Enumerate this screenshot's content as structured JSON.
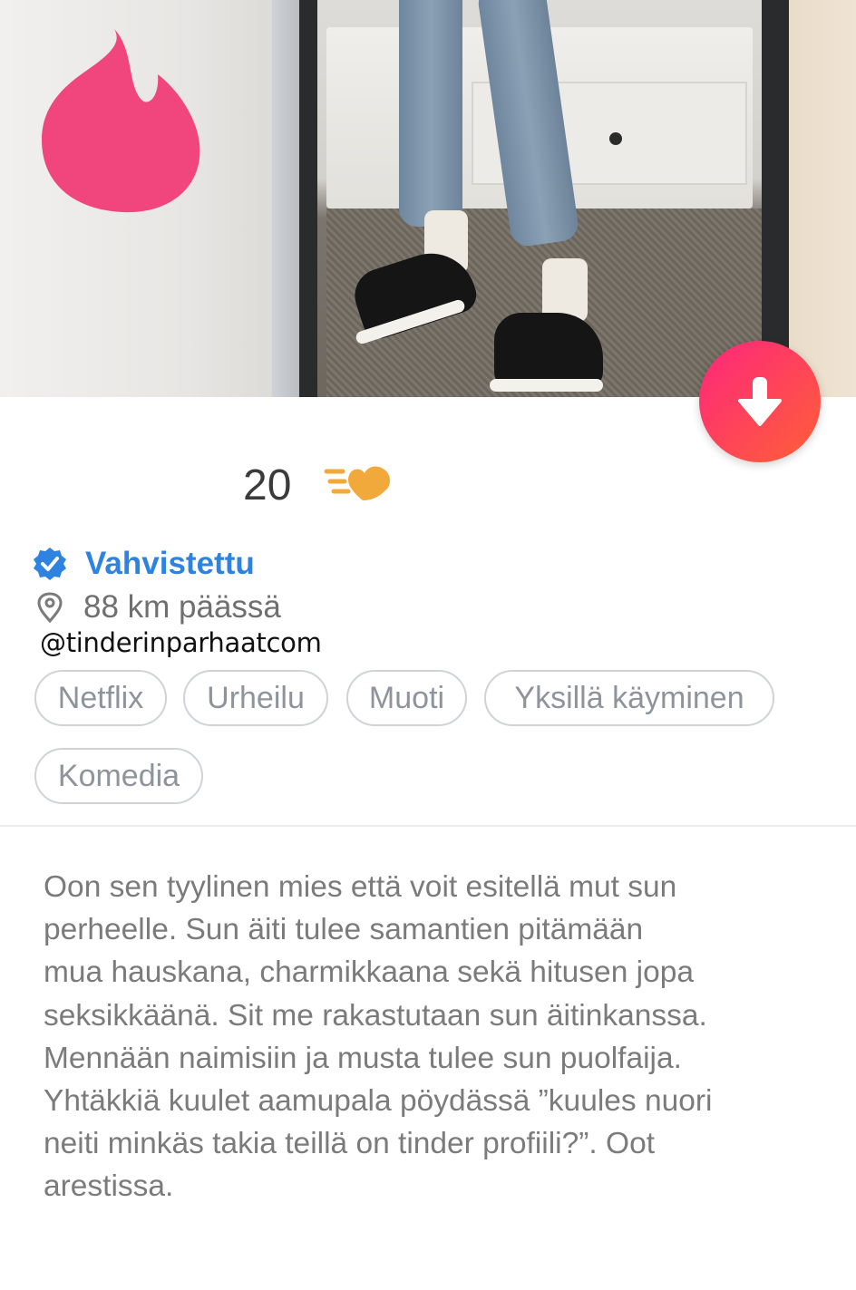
{
  "profile": {
    "age": "20",
    "verified_label": "Vahvistettu",
    "distance": "88 km päässä",
    "watermark": "@tinderinparhaatcom",
    "interests": [
      "Netflix",
      "Urheilu",
      "Muoti",
      "Yksillä käyminen",
      "Komedia"
    ],
    "bio": "Oon sen tyylinen mies että voit esitellä mut sun\nperheelle. Sun äiti tulee samantien pitämään\nmua hauskana, charmikkaana sekä hitusen jopa\nseksikkäänä. Sit me rakastutaan sun äitinkanssa.\nMennään naimisiin ja musta tulee sun puolfaija.\nYhtäkkiä kuulet aamupala pöydässä ”kuules nuori\nneiti minkäs takia teillä on tinder profiili?”. Oot\narestissa."
  },
  "icons": {
    "logo": "tinder-flame-icon",
    "collapse": "arrow-down-icon",
    "swipe": "swipe-heart-icon",
    "verified": "verified-badge-icon",
    "location": "location-pin-icon"
  },
  "colors": {
    "brand_pink": "#f0457d",
    "gradient_start": "#fd267d",
    "gradient_end": "#ff6036",
    "verified_blue": "#2f83e0",
    "swipe_orange": "#f2a93b"
  }
}
